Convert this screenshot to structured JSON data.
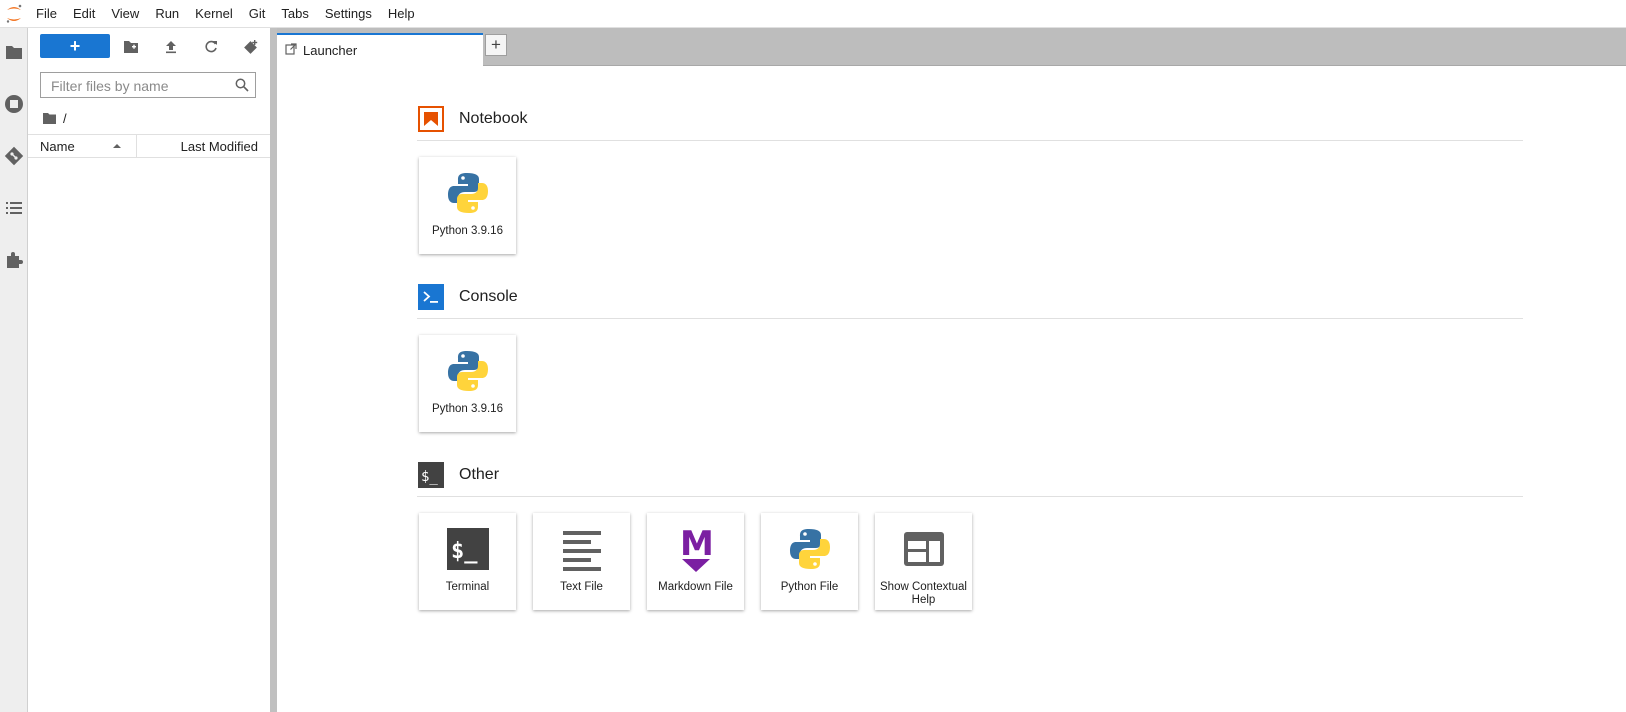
{
  "menubar": {
    "items": [
      "File",
      "Edit",
      "View",
      "Run",
      "Kernel",
      "Git",
      "Tabs",
      "Settings",
      "Help"
    ]
  },
  "iconbar": {
    "icons": [
      "folder-icon",
      "running-icon",
      "git-icon",
      "toc-icon",
      "extension-icon"
    ]
  },
  "filebrowser": {
    "new_label": "+",
    "filter_placeholder": "Filter files by name",
    "breadcrumb": "/",
    "columns": {
      "name": "Name",
      "last_modified": "Last Modified"
    }
  },
  "dock": {
    "tab_label": "Launcher",
    "add_tab_label": "+"
  },
  "launcher": {
    "sections": [
      {
        "title": "Notebook",
        "cards": [
          {
            "label": "Python 3.9.16",
            "icon": "python-icon"
          }
        ]
      },
      {
        "title": "Console",
        "cards": [
          {
            "label": "Python 3.9.16",
            "icon": "python-icon"
          }
        ]
      },
      {
        "title": "Other",
        "cards": [
          {
            "label": "Terminal",
            "icon": "terminal-icon"
          },
          {
            "label": "Text File",
            "icon": "text-file-icon"
          },
          {
            "label": "Markdown File",
            "icon": "markdown-icon"
          },
          {
            "label": "Python File",
            "icon": "python-icon"
          },
          {
            "label": "Show Contextual Help",
            "icon": "contextual-help-icon"
          }
        ]
      }
    ]
  },
  "colors": {
    "accent": "#1976d2",
    "notebook_orange": "#e65100",
    "terminal_dark": "#424242",
    "markdown_purple": "#7b1fa2"
  }
}
